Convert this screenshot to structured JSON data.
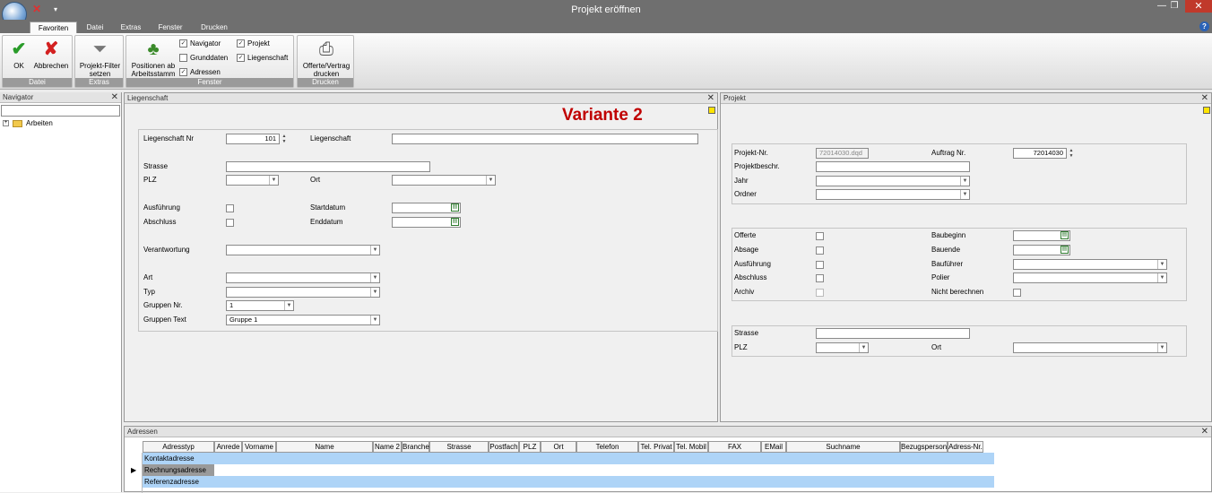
{
  "window": {
    "title": "Projekt eröffnen"
  },
  "tabs": [
    "Favoriten",
    "Datei",
    "Extras",
    "Fenster",
    "Drucken"
  ],
  "ribbon": {
    "ok_label": "OK",
    "abbrechen_label": "Abbrechen",
    "filter_label1": "Projekt-Filter",
    "filter_label2": "setzen",
    "positionen_label1": "Positionen ab",
    "positionen_label2": "Arbeitsstamm",
    "checks": {
      "navigator": "Navigator",
      "projekt": "Projekt",
      "grunddaten": "Grunddaten",
      "liegenschaft": "Liegenschaft",
      "adressen": "Adressen"
    },
    "offerte_label1": "Offerte/Vertrag",
    "offerte_label2": "drucken",
    "groups": {
      "datei": "Datei",
      "extras": "Extras",
      "fenster": "Fenster",
      "drucken": "Drucken"
    }
  },
  "navigator": {
    "title": "Navigator",
    "tree_item": "Arbeiten"
  },
  "liegenschaft": {
    "title": "Liegenschaft",
    "variante": "Variante 2",
    "labels": {
      "nr": "Liegenschaft Nr",
      "liegenschaft": "Liegenschaft",
      "strasse": "Strasse",
      "plz": "PLZ",
      "ort": "Ort",
      "ausfuehrung": "Ausführung",
      "abschluss": "Abschluss",
      "startdatum": "Startdatum",
      "enddatum": "Enddatum",
      "verantwortung": "Verantwortung",
      "art": "Art",
      "typ": "Typ",
      "gruppen_nr": "Gruppen Nr.",
      "gruppen_text": "Gruppen Text"
    },
    "values": {
      "nr": "101",
      "gruppen_nr": "1",
      "gruppen_text": "Gruppe 1"
    }
  },
  "projekt": {
    "title": "Projekt",
    "labels": {
      "projekt_nr": "Projekt-Nr.",
      "auftrag_nr": "Auftrag Nr.",
      "beschr": "Projektbeschr.",
      "jahr": "Jahr",
      "ordner": "Ordner",
      "offerte": "Offerte",
      "baubeginn": "Baubeginn",
      "absage": "Absage",
      "bauende": "Bauende",
      "ausfuehrung": "Ausführung",
      "baufuehrer": "Bauführer",
      "abschluss": "Abschluss",
      "polier": "Polier",
      "archiv": "Archiv",
      "nicht_berechnen": "Nicht berechnen",
      "strasse": "Strasse",
      "plz": "PLZ",
      "ort": "Ort"
    },
    "values": {
      "projekt_nr": "72014030.dqd",
      "auftrag_nr": "72014030"
    }
  },
  "adressen": {
    "title": "Adressen",
    "columns": [
      "Adresstyp",
      "Anrede",
      "Vorname",
      "Name",
      "Name 2",
      "Branche",
      "Strasse",
      "Postfach",
      "PLZ",
      "Ort",
      "Telefon",
      "Tel. Privat",
      "Tel. Mobil",
      "FAX",
      "EMail",
      "Suchname",
      "Bezugsperson",
      "Adress-Nr."
    ],
    "rows": [
      "Kontaktadresse",
      "Rechnungsadresse",
      "Referenzadresse"
    ]
  },
  "colors": {
    "titlebar": "#6f6f6f",
    "accent": "#c00000",
    "row_highlight": "#aed4f7",
    "close_button": "#c0392b"
  }
}
